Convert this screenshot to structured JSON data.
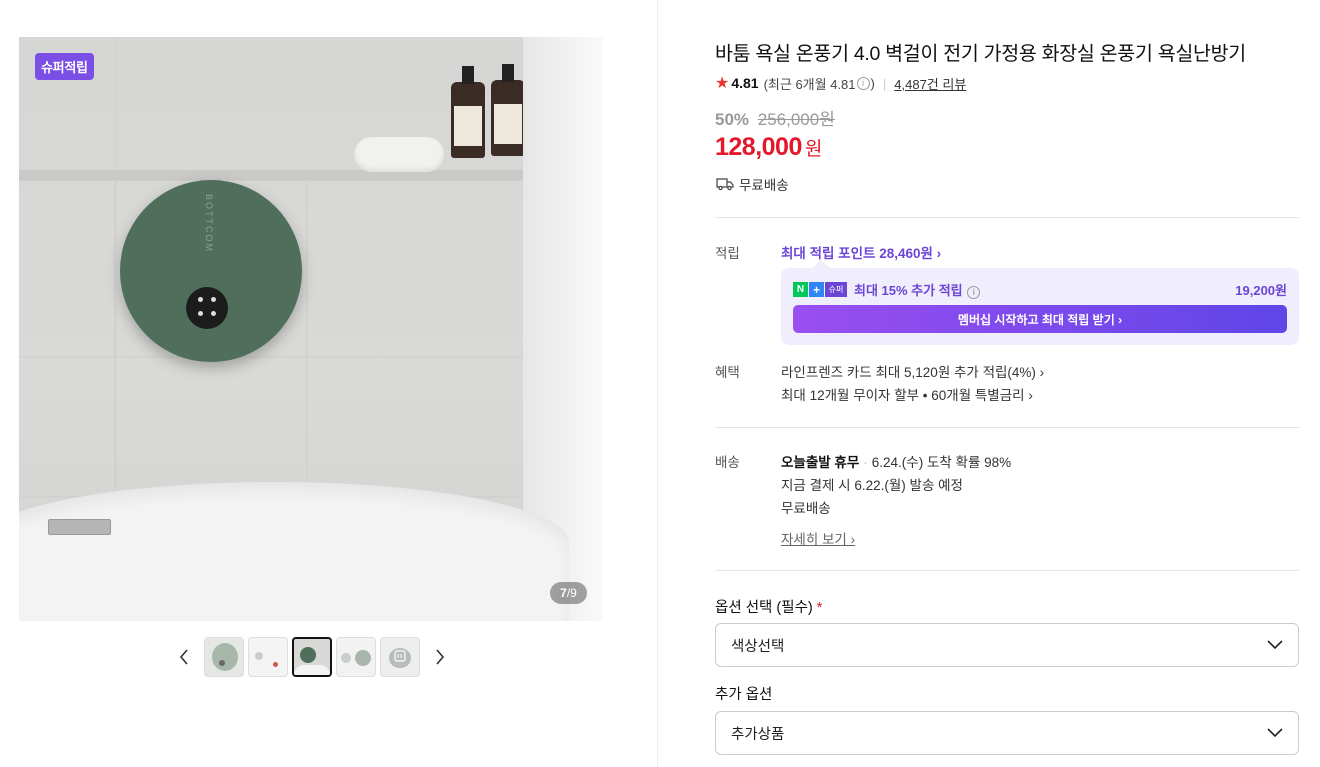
{
  "gallery": {
    "badge": "슈퍼적립",
    "brand_mark": "BOTTCOM",
    "counter_current": "7",
    "counter_total": "/9",
    "prev_icon": "chevron-left-icon",
    "next_icon": "chevron-right-icon",
    "thumbnail_count": 5,
    "active_thumbnail": 3
  },
  "product": {
    "title": "바툼 욕실 온풍기 4.0 벽걸이 전기 가정용 화장실 온풍기 욕실난방기",
    "rating": "4.81",
    "recent_rating_text": "(최근 6개월 4.81",
    "recent_rating_close": ")",
    "review_count": "4,487건 리뷰",
    "discount_rate": "50%",
    "original_price": "256,000원",
    "price": "128,000",
    "price_unit": "원",
    "shipping_tag": "무료배송"
  },
  "points": {
    "label": "적립",
    "max_points": "최대 적립 포인트 28,460원 ›",
    "npay_text": "최대 15% 추가 적립",
    "npay_amount": "19,200원",
    "membership_button": "멤버십 시작하고 최대 적립 받기 ›"
  },
  "benefits": {
    "label": "혜택",
    "line1": "라인프렌즈 카드 최대 5,120원 추가 적립(4%) ›",
    "line2": "최대 12개월 무이자 할부 • 60개월 특별금리 ›"
  },
  "delivery": {
    "label": "배송",
    "today": "오늘출발 휴무",
    "eta": "6.24.(수) 도착 확률 98%",
    "dispatch": "지금 결제 시 6.22.(월) 발송 예정",
    "fee": "무료배송",
    "detail_link": "자세히 보기 ›"
  },
  "options": {
    "required_label": "옵션 선택 (필수)",
    "required_mark": "*",
    "color_select": "색상선택",
    "extra_label": "추가 옵션",
    "extra_select": "추가상품"
  },
  "colors": {
    "accent_purple": "#6b46d6",
    "price_red": "#e5172b",
    "star": "#e8352e"
  }
}
